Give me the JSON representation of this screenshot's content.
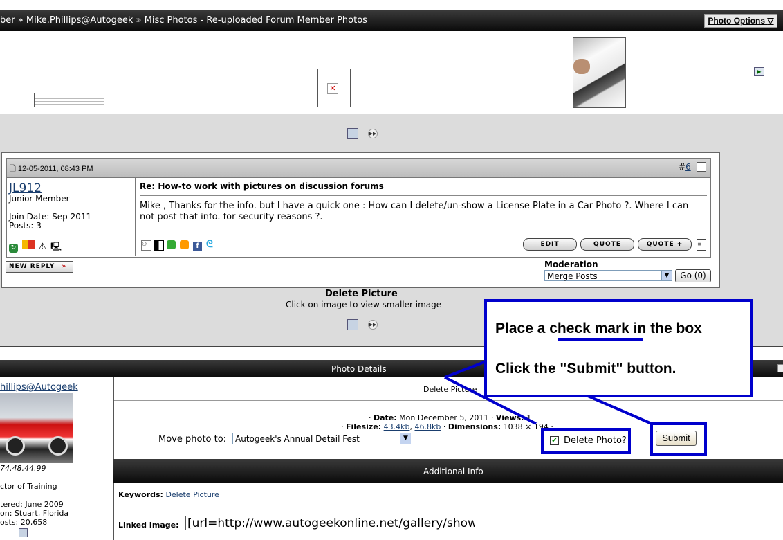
{
  "breadcrumb": {
    "part1": "ber",
    "sep1": "»",
    "part2": "Mike.Phillips@Autogeek",
    "sep2": "»",
    "part3": "Misc Photos - Re-uploaded Forum Member Photos"
  },
  "photo_options": {
    "label": "Photo Options"
  },
  "post": {
    "date": "12-05-2011, 08:43 PM",
    "number_prefix": "#",
    "number": "6",
    "username": "JL912",
    "rank": "Junior Member",
    "join_date": "Join Date: Sep 2011",
    "posts": "Posts: 3",
    "title": "Re: How-to work with pictures on discussion forums",
    "body": "Mike , Thanks for the info. but I have a quick one : How can I delete/un-show a License Plate in a Car Photo ?. Where I can not post that info. for security reasons ?.",
    "buttons": {
      "edit": "EDIT",
      "quote": "QUOTE",
      "quote_plus": "QUOTE +"
    },
    "new_reply": "NEW REPLY",
    "new_reply_arrows": "»"
  },
  "moderation": {
    "label": "Moderation",
    "selected": "Merge Posts",
    "go": "Go (0)"
  },
  "caption": {
    "title": "Delete Picture",
    "subtitle": "Click on image to view smaller image"
  },
  "details": {
    "bar_title": "Photo Details",
    "photo_title": "Delete Picture",
    "date_label": "Date:",
    "date_value": "Mon December 5, 2011",
    "views_label": "Views:",
    "views_value": "1",
    "filesize_label": "Filesize:",
    "filesize_a": "43.4kb",
    "filesize_b": "46.8kb",
    "dimensions_label": "Dimensions:",
    "dimensions_value": "1038 × 194",
    "move_label": "Move photo to:",
    "move_selected": "Autogeek's Annual Detail Fest",
    "delete_label": "Delete Photo?",
    "delete_checked": true,
    "submit": "Submit"
  },
  "uploader": {
    "name": "hillips@Autogeek",
    "ip": "74.48.44.99",
    "title": "ctor of Training",
    "joined": "tered: June 2009",
    "location": "on: Stuart, Florida",
    "posts": "osts: 20,658"
  },
  "additional": {
    "bar_title": "Additional Info",
    "keywords_label": "Keywords:",
    "keyword1": "Delete",
    "keyword2": "Picture",
    "linked_label": "Linked Image:",
    "linked_value": "[url=http://www.autogeekonline.net/gallery/showp"
  },
  "annotation": {
    "line1_pre": "Place a ",
    "line1_em": "check mark",
    "line1_post": " in the box",
    "line2": "Click the \"Submit\" button.",
    "color": "#0000cc"
  }
}
